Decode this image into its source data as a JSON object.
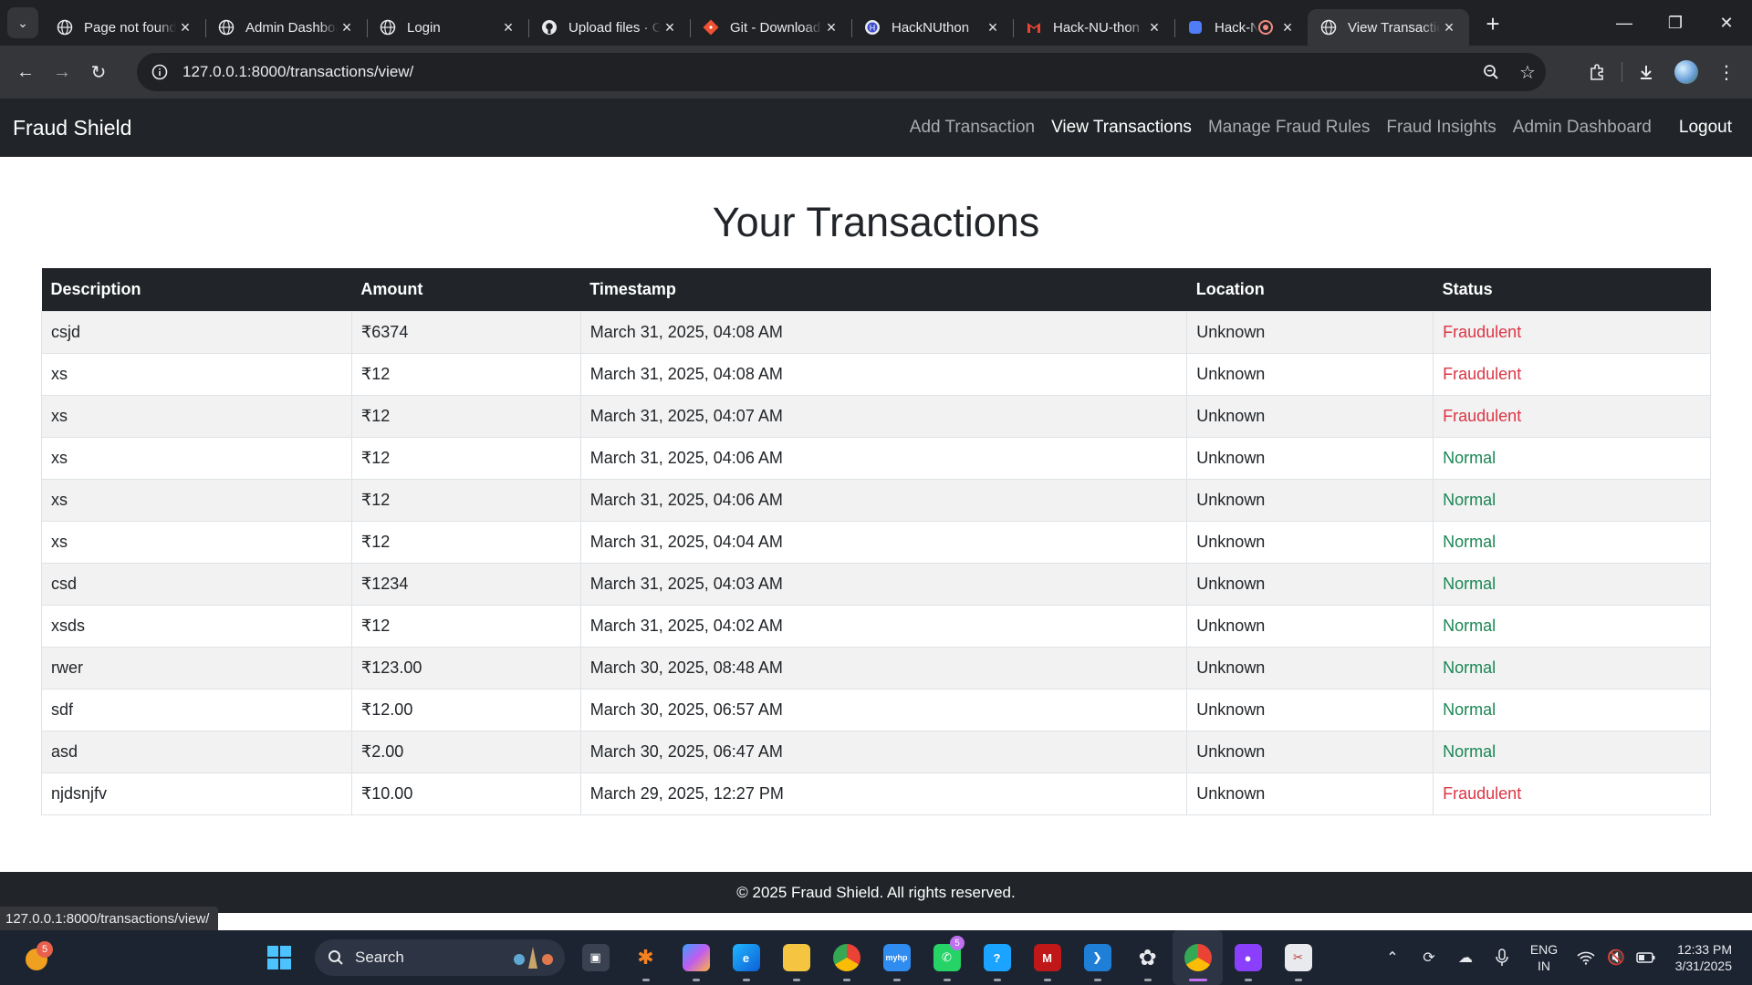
{
  "browser": {
    "tabs": [
      {
        "title": "Page not found",
        "favicon": "globe-icon"
      },
      {
        "title": "Admin Dashboard",
        "favicon": "globe-icon"
      },
      {
        "title": "Login",
        "favicon": "globe-icon"
      },
      {
        "title": "Upload files · GitHub",
        "favicon": "github-icon"
      },
      {
        "title": "Git - Downloads",
        "favicon": "git-icon"
      },
      {
        "title": "HackNUthon",
        "favicon": "hacknuthon-icon"
      },
      {
        "title": "Hack-NU-thon",
        "favicon": "gmail-icon"
      },
      {
        "title": "Hack-NU",
        "favicon": "docs-icon"
      },
      {
        "title": "View Transactions",
        "favicon": "globe-icon"
      }
    ],
    "url": "127.0.0.1:8000/transactions/view/",
    "hover_status_url": "127.0.0.1:8000/transactions/view/"
  },
  "navbar": {
    "brand": "Fraud Shield",
    "links": [
      {
        "label": "Add Transaction"
      },
      {
        "label": "View Transactions"
      },
      {
        "label": "Manage Fraud Rules"
      },
      {
        "label": "Fraud Insights"
      },
      {
        "label": "Admin Dashboard"
      },
      {
        "label": "Logout"
      }
    ]
  },
  "page": {
    "title": "Your Transactions",
    "columns": [
      "Description",
      "Amount",
      "Timestamp",
      "Location",
      "Status"
    ],
    "rows": [
      {
        "description": "csjd",
        "amount": "₹6374",
        "timestamp": "March 31, 2025, 04:08 AM",
        "location": "Unknown",
        "status": "Fraudulent"
      },
      {
        "description": "xs",
        "amount": "₹12",
        "timestamp": "March 31, 2025, 04:08 AM",
        "location": "Unknown",
        "status": "Fraudulent"
      },
      {
        "description": "xs",
        "amount": "₹12",
        "timestamp": "March 31, 2025, 04:07 AM",
        "location": "Unknown",
        "status": "Fraudulent"
      },
      {
        "description": "xs",
        "amount": "₹12",
        "timestamp": "March 31, 2025, 04:06 AM",
        "location": "Unknown",
        "status": "Normal"
      },
      {
        "description": "xs",
        "amount": "₹12",
        "timestamp": "March 31, 2025, 04:06 AM",
        "location": "Unknown",
        "status": "Normal"
      },
      {
        "description": "xs",
        "amount": "₹12",
        "timestamp": "March 31, 2025, 04:04 AM",
        "location": "Unknown",
        "status": "Normal"
      },
      {
        "description": "csd",
        "amount": "₹1234",
        "timestamp": "March 31, 2025, 04:03 AM",
        "location": "Unknown",
        "status": "Normal"
      },
      {
        "description": "xsds",
        "amount": "₹12",
        "timestamp": "March 31, 2025, 04:02 AM",
        "location": "Unknown",
        "status": "Normal"
      },
      {
        "description": "rwer",
        "amount": "₹123.00",
        "timestamp": "March 30, 2025, 08:48 AM",
        "location": "Unknown",
        "status": "Normal"
      },
      {
        "description": "sdf",
        "amount": "₹12.00",
        "timestamp": "March 30, 2025, 06:57 AM",
        "location": "Unknown",
        "status": "Normal"
      },
      {
        "description": "asd",
        "amount": "₹2.00",
        "timestamp": "March 30, 2025, 06:47 AM",
        "location": "Unknown",
        "status": "Normal"
      },
      {
        "description": "njdsnjfv",
        "amount": "₹10.00",
        "timestamp": "March 29, 2025, 12:27 PM",
        "location": "Unknown",
        "status": "Fraudulent"
      }
    ]
  },
  "footer": {
    "text": "© 2025 Fraud Shield. All rights reserved."
  },
  "colors": {
    "navbar_bg": "#212529",
    "fraud": "#dc3545",
    "normal": "#198754"
  },
  "taskbar": {
    "weather_badge": "5",
    "search_label": "Search",
    "apps": [
      {
        "name": "task-view-icon"
      },
      {
        "name": "orange-app-icon"
      },
      {
        "name": "copilot-icon"
      },
      {
        "name": "edge-icon"
      },
      {
        "name": "file-explorer-icon"
      },
      {
        "name": "chrome-icon"
      },
      {
        "name": "myhp-icon"
      },
      {
        "name": "whatsapp-icon",
        "badge": "5"
      },
      {
        "name": "help-icon"
      },
      {
        "name": "mcafee-icon"
      },
      {
        "name": "vscode-icon"
      },
      {
        "name": "chatgpt-icon"
      },
      {
        "name": "chrome-active-icon"
      },
      {
        "name": "github-desktop-icon"
      },
      {
        "name": "snipping-tool-icon"
      }
    ],
    "lang_line1": "ENG",
    "lang_line2": "IN",
    "time": "12:33 PM",
    "date": "3/31/2025"
  }
}
